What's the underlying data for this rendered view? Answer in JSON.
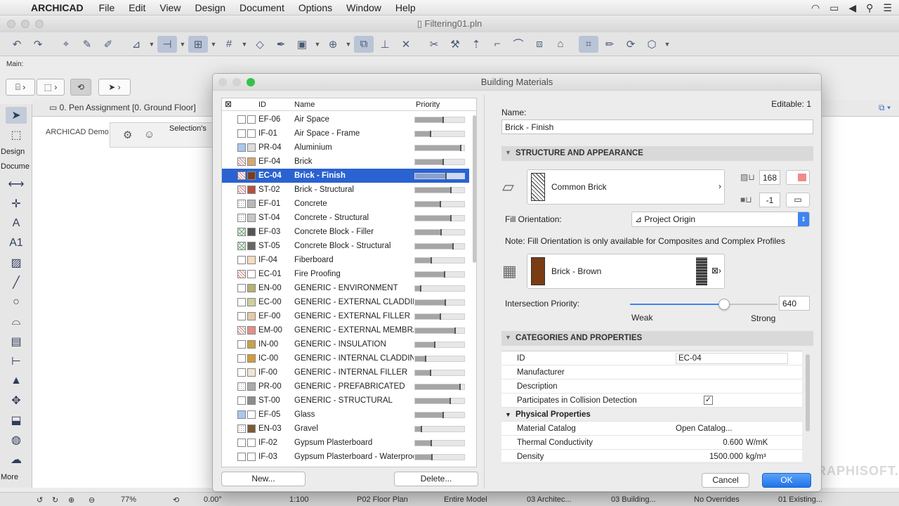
{
  "menubar": {
    "app": "ARCHICAD",
    "items": [
      "File",
      "Edit",
      "View",
      "Design",
      "Document",
      "Options",
      "Window",
      "Help"
    ]
  },
  "window": {
    "title": "Filtering01.pln"
  },
  "infobox": {
    "label": "Main:"
  },
  "toolbox": {
    "design": "Design",
    "document": "Docume",
    "more": "More"
  },
  "view_tab": {
    "label": "0. Pen Assignment [0. Ground Floor]"
  },
  "canvas": {
    "demo_label": "ARCHICAD Demo",
    "selection_label": "Selection's"
  },
  "status": {
    "zoom": "77%",
    "angle": "0.00°",
    "scale": "1:100",
    "layout": "P02 Floor Plan",
    "model": "Entire Model",
    "pen": "03 Architec...",
    "layer": "03 Building...",
    "override": "No Overrides",
    "existing": "01 Existing..."
  },
  "brand_text": "GRAPHISOFT.",
  "dialog": {
    "title": "Building Materials",
    "columns": {
      "id": "ID",
      "name": "Name",
      "priority": "Priority"
    },
    "materials": [
      {
        "id": "EF-06",
        "name": "Air Space",
        "priority": 0.55,
        "swatch": "#ffffff",
        "pattern": "plain"
      },
      {
        "id": "IF-01",
        "name": "Air Space - Frame",
        "priority": 0.3,
        "swatch": "#ffffff",
        "pattern": "plain"
      },
      {
        "id": "PR-04",
        "name": "Aluminium",
        "priority": 0.92,
        "swatch": "#dcdcdc",
        "pattern": "blue"
      },
      {
        "id": "EF-04",
        "name": "Brick",
        "priority": 0.55,
        "swatch": "#d6a871",
        "pattern": "hatch"
      },
      {
        "id": "EC-04",
        "name": "Brick - Finish",
        "priority": 0.62,
        "swatch": "#7a3c1b",
        "pattern": "hatch"
      },
      {
        "id": "ST-02",
        "name": "Brick - Structural",
        "priority": 0.72,
        "swatch": "#b5503f",
        "pattern": "hatch"
      },
      {
        "id": "EF-01",
        "name": "Concrete",
        "priority": 0.5,
        "swatch": "#b8b8b8",
        "pattern": "dots"
      },
      {
        "id": "ST-04",
        "name": "Concrete - Structural",
        "priority": 0.72,
        "swatch": "#c7c7c7",
        "pattern": "dots"
      },
      {
        "id": "EF-03",
        "name": "Concrete Block - Filler",
        "priority": 0.52,
        "swatch": "#555555",
        "pattern": "xh"
      },
      {
        "id": "ST-05",
        "name": "Concrete Block - Structural",
        "priority": 0.75,
        "swatch": "#666666",
        "pattern": "xh"
      },
      {
        "id": "IF-04",
        "name": "Fiberboard",
        "priority": 0.32,
        "swatch": "#f5dcc0",
        "pattern": "plain"
      },
      {
        "id": "EC-01",
        "name": "Fire Proofing",
        "priority": 0.58,
        "swatch": "#ffffff",
        "pattern": "hatch"
      },
      {
        "id": "EN-00",
        "name": "GENERIC - ENVIRONMENT",
        "priority": 0.1,
        "swatch": "#b8b070",
        "pattern": "plain"
      },
      {
        "id": "EC-00",
        "name": "GENERIC - EXTERNAL CLADDING",
        "priority": 0.6,
        "swatch": "#cfcf9a",
        "pattern": "plain"
      },
      {
        "id": "EF-00",
        "name": "GENERIC - EXTERNAL FILLER",
        "priority": 0.5,
        "swatch": "#e2c9a8",
        "pattern": "plain"
      },
      {
        "id": "EM-00",
        "name": "GENERIC - EXTERNAL MEMBRANE",
        "priority": 0.8,
        "swatch": "#e38f86",
        "pattern": "hatch"
      },
      {
        "id": "IN-00",
        "name": "GENERIC - INSULATION",
        "priority": 0.38,
        "swatch": "#c9a14a",
        "pattern": "plain"
      },
      {
        "id": "IC-00",
        "name": "GENERIC - INTERNAL CLADDING",
        "priority": 0.2,
        "swatch": "#d19c3d",
        "pattern": "plain"
      },
      {
        "id": "IF-00",
        "name": "GENERIC - INTERNAL FILLER",
        "priority": 0.3,
        "swatch": "#f0e6d2",
        "pattern": "plain"
      },
      {
        "id": "PR-00",
        "name": "GENERIC - PREFABRICATED",
        "priority": 0.9,
        "swatch": "#aaaaaa",
        "pattern": "dots"
      },
      {
        "id": "ST-00",
        "name": "GENERIC - STRUCTURAL",
        "priority": 0.7,
        "swatch": "#8c8c8c",
        "pattern": "plain"
      },
      {
        "id": "EF-05",
        "name": "Glass",
        "priority": 0.55,
        "swatch": "#ffffff",
        "pattern": "blue"
      },
      {
        "id": "EN-03",
        "name": "Gravel",
        "priority": 0.12,
        "swatch": "#7a5a3a",
        "pattern": "dots"
      },
      {
        "id": "IF-02",
        "name": "Gypsum Plasterboard",
        "priority": 0.32,
        "swatch": "#ffffff",
        "pattern": "plain"
      },
      {
        "id": "IF-03",
        "name": "Gypsum Plasterboard - Waterproof",
        "priority": 0.33,
        "swatch": "#ffffff",
        "pattern": "plain"
      }
    ],
    "selected_index": 4,
    "buttons": {
      "new": "New...",
      "delete": "Delete...",
      "cancel": "Cancel",
      "ok": "OK"
    },
    "editable": "Editable: 1",
    "name_label": "Name:",
    "name_value": "Brick - Finish",
    "structure_section": "STRUCTURE AND APPEARANCE",
    "cut_fill": "Common Brick",
    "cut_fill_pen": "168",
    "bg_pen": "-1",
    "fill_orientation_label": "Fill Orientation:",
    "fill_orientation_value": "Project Origin",
    "note": "Note: Fill Orientation is only available for Composites and Complex Profiles",
    "surface": "Brick - Brown",
    "surface_color": "#7a3c12",
    "intersection_label": "Intersection Priority:",
    "intersection_value": "640",
    "intersection_fraction": 0.64,
    "weak": "Weak",
    "strong": "Strong",
    "categories_section": "CATEGORIES AND PROPERTIES",
    "properties": [
      {
        "name": "ID",
        "value": "EC-04",
        "unit": "",
        "group": false,
        "input": true
      },
      {
        "name": "Manufacturer",
        "value": "",
        "unit": "",
        "group": false
      },
      {
        "name": "Description",
        "value": "",
        "unit": "",
        "group": false
      },
      {
        "name": "Participates in Collision Detection",
        "value": "✓",
        "unit": "",
        "group": false,
        "check": true
      },
      {
        "name": "Physical Properties",
        "value": "",
        "unit": "",
        "group": true
      },
      {
        "name": "Material Catalog",
        "value": "Open Catalog...",
        "unit": "",
        "group": false
      },
      {
        "name": "Thermal Conductivity",
        "value": "0.600",
        "unit": "W/mK",
        "group": false
      },
      {
        "name": "Density",
        "value": "1500.000",
        "unit": "kg/m³",
        "group": false
      }
    ]
  }
}
